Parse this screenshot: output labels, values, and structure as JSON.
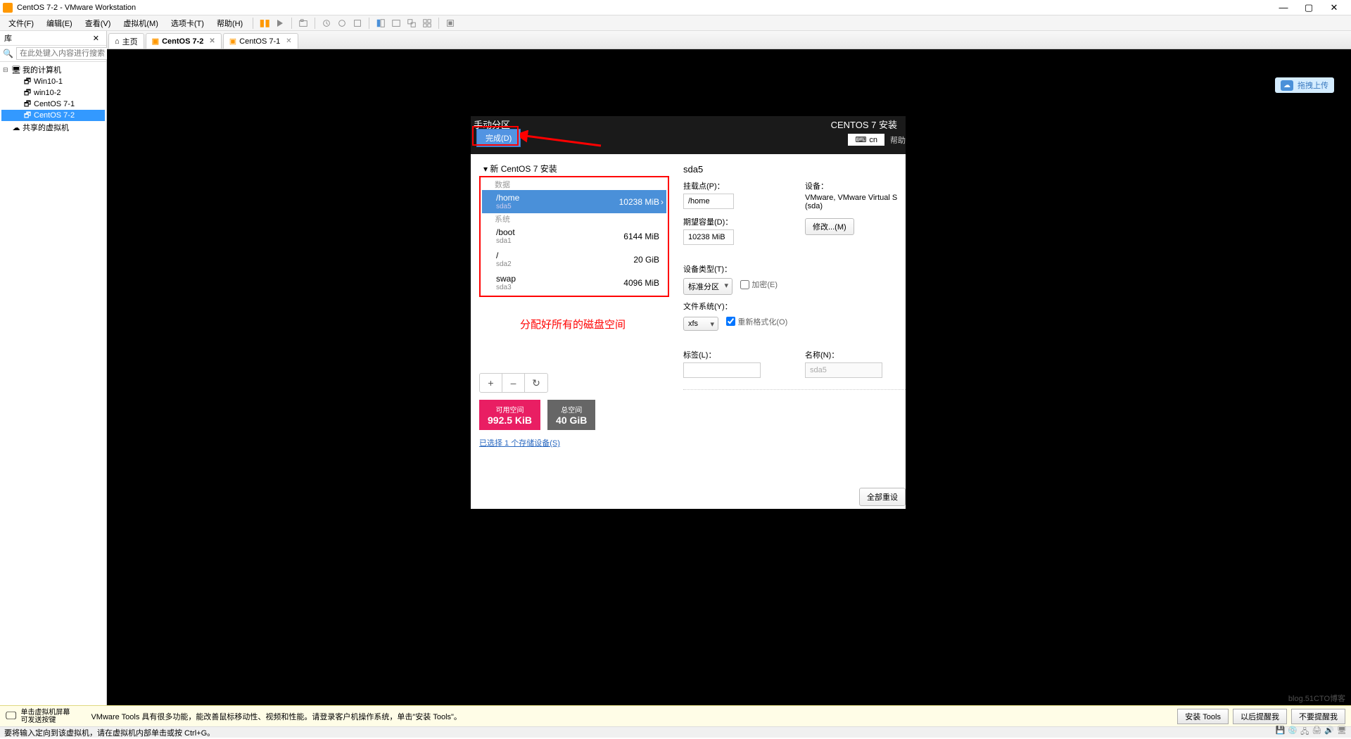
{
  "window": {
    "title": "CentOS 7-2 - VMware Workstation",
    "minimize": "—",
    "maximize": "▢",
    "close": "✕"
  },
  "menus": {
    "file": "文件(F)",
    "edit": "编辑(E)",
    "view": "查看(V)",
    "vm": "虚拟机(M)",
    "tabs": "选项卡(T)",
    "help": "帮助(H)"
  },
  "sidebar": {
    "header": "库",
    "search_placeholder": "在此处键入内容进行搜索",
    "root": "我的计算机",
    "items": [
      "Win10-1",
      "win10-2",
      "CentOS 7-1",
      "CentOS 7-2"
    ],
    "shared": "共享的虚拟机"
  },
  "tabs": [
    {
      "label": "主页",
      "icon": "home"
    },
    {
      "label": "CentOS 7-2",
      "icon": "vm",
      "active": true,
      "closable": true
    },
    {
      "label": "CentOS 7-1",
      "icon": "vm",
      "closable": true
    }
  ],
  "installer": {
    "title": "手动分区",
    "done": "完成(D)",
    "header_title": "CENTOS 7 安装",
    "lang": "cn",
    "help": "帮助",
    "new_install": "新 CentOS 7 安装",
    "group_data": "数据",
    "group_system": "系统",
    "partitions": [
      {
        "mount": "/home",
        "dev": "sda5",
        "size": "10238 MiB",
        "selected": true
      },
      {
        "mount": "/boot",
        "dev": "sda1",
        "size": "6144 MiB"
      },
      {
        "mount": "/",
        "dev": "sda2",
        "size": "20 GiB"
      },
      {
        "mount": "swap",
        "dev": "sda3",
        "size": "4096 MiB"
      }
    ],
    "tool_add": "+",
    "tool_remove": "–",
    "tool_refresh": "↻",
    "free_space_label": "可用空间",
    "free_space": "992.5 KiB",
    "total_space_label": "总空间",
    "total_space": "40 GiB",
    "storage_link": "已选择 1 个存储设备(S)",
    "details": {
      "heading": "sda5",
      "mount_label": "挂载点(P)：",
      "mount_value": "/home",
      "device_label": "设备：",
      "device_value": "VMware, VMware Virtual S (sda)",
      "capacity_label": "期望容量(D)：",
      "capacity_value": "10238 MiB",
      "modify": "修改...(M)",
      "devtype_label": "设备类型(T)：",
      "devtype_value": "标准分区",
      "encrypt": "加密(E)",
      "fs_label": "文件系统(Y)：",
      "fs_value": "xfs",
      "reformat": "重新格式化(O)",
      "tag_label": "标签(L)：",
      "name_label": "名称(N)：",
      "name_value": "sda5",
      "reset_btn": "全部重设"
    },
    "annotation": "分配好所有的磁盘空间"
  },
  "vmtools": {
    "click_hint1": "单击虚拟机屏幕",
    "click_hint2": "可发送按键",
    "message": "VMware Tools 具有很多功能，能改善鼠标移动性、视频和性能。请登录客户机操作系统，单击\"安装 Tools\"。",
    "install": "安装 Tools",
    "remind_later": "以后提醒我",
    "never_remind": "不要提醒我"
  },
  "status_bar": "要将输入定向到该虚拟机，请在虚拟机内部单击或按 Ctrl+G。",
  "upload_badge": "拖拽上传",
  "watermark": "blog.51CTO博客"
}
